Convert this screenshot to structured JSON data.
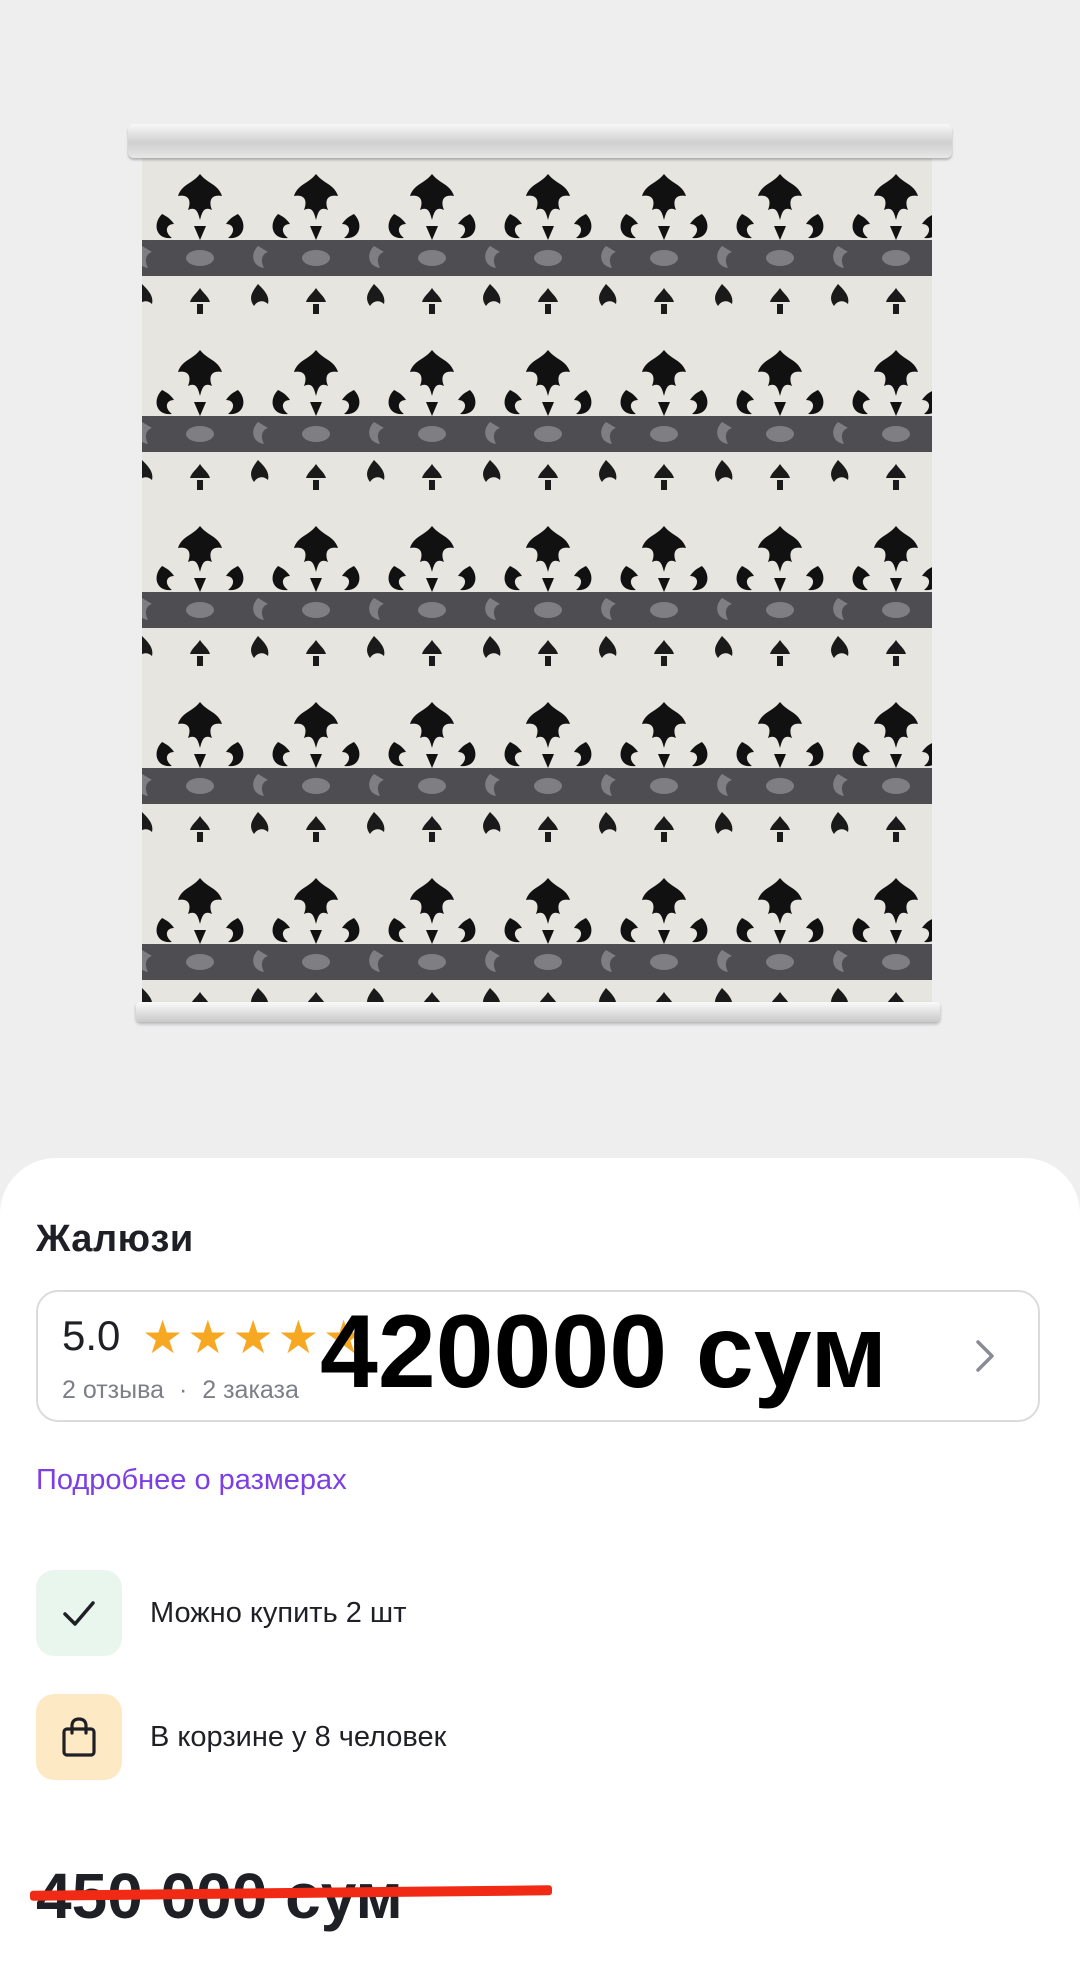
{
  "product": {
    "title": "Жалюзи",
    "image_icon": "roller-blind-damask-pattern"
  },
  "rating": {
    "score": "5.0",
    "stars": 5,
    "reviews": "2 отзыва",
    "separator": "·",
    "orders": "2 заказа"
  },
  "price_overlay": "420000 сум",
  "size_link": "Подробнее о размерах",
  "features": [
    {
      "icon": "checkmark-icon",
      "text": "Можно купить 2 шт"
    },
    {
      "icon": "shopping-bag-icon",
      "text": "В корзине у 8 человек"
    }
  ],
  "old_price": "450 000 сум",
  "colors": {
    "accent_link": "#7b3fe4",
    "star": "#f7a823",
    "strike": "#f02a15",
    "feature_green_bg": "#e9f6ee",
    "feature_yellow_bg": "#fde9c4"
  }
}
